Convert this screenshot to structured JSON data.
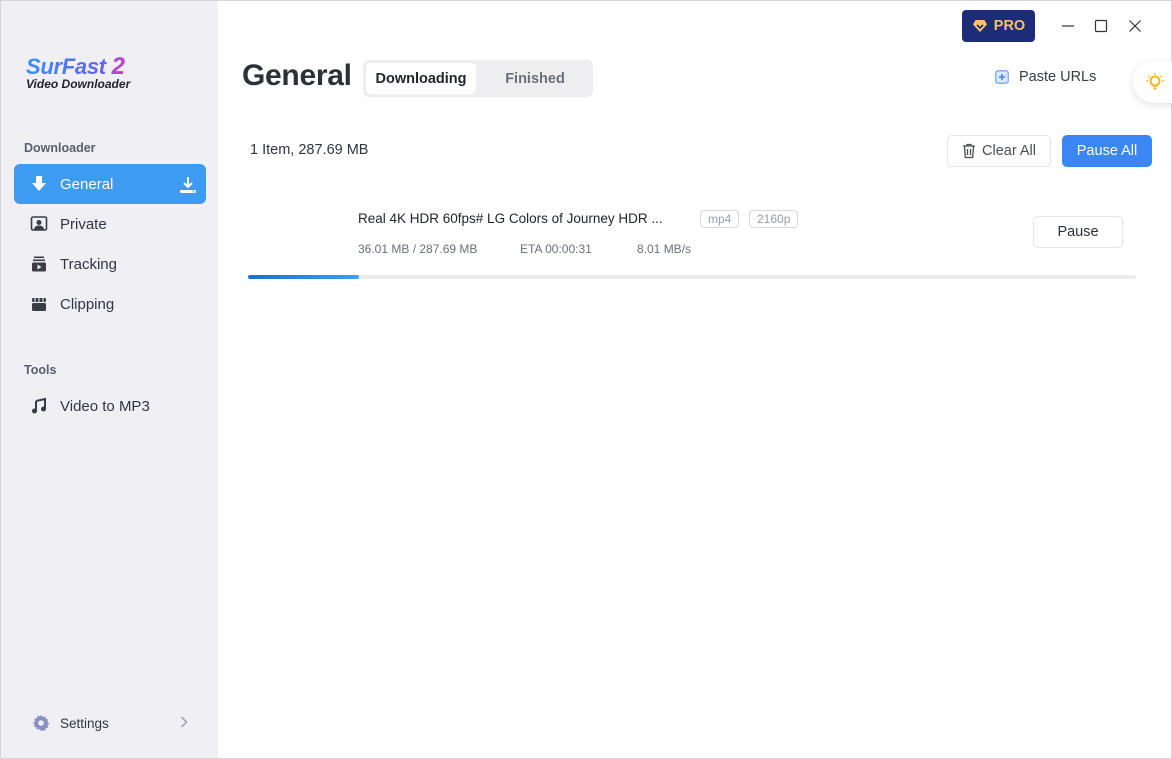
{
  "app": {
    "logo_line1": "SurFast",
    "logo_version": "2",
    "logo_line2": "Video Downloader"
  },
  "window_controls": {
    "pro_label": "PRO",
    "minimize": "minimize-icon",
    "maximize": "maximize-icon",
    "close": "close-icon"
  },
  "sidebar": {
    "sections": [
      {
        "label": "Downloader",
        "items": [
          {
            "label": "General",
            "icon": "download-arrow-icon",
            "active": true
          },
          {
            "label": "Private",
            "icon": "private-user-icon",
            "active": false
          },
          {
            "label": "Tracking",
            "icon": "tracking-play-icon",
            "active": false
          },
          {
            "label": "Clipping",
            "icon": "clapper-icon",
            "active": false
          }
        ]
      },
      {
        "label": "Tools",
        "items": [
          {
            "label": "Video to MP3",
            "icon": "music-note-icon",
            "active": false
          }
        ]
      }
    ],
    "settings_label": "Settings"
  },
  "main": {
    "title": "General",
    "tabs": [
      {
        "label": "Downloading",
        "active": true
      },
      {
        "label": "Finished",
        "active": false
      }
    ],
    "paste_urls_label": "Paste URLs",
    "summary": "1 Item, 287.69 MB",
    "clear_all_label": "Clear All",
    "pause_all_label": "Pause All",
    "accent_color": "#3b86f5",
    "downloads": [
      {
        "title": "Real 4K HDR 60fps# LG Colors of Journey HDR ...",
        "format": "mp4",
        "resolution": "2160p",
        "size_progress": "36.01 MB / 287.69 MB",
        "eta": "ETA 00:00:31",
        "speed": "8.01 MB/s",
        "progress_percent": 12.5,
        "action_label": "Pause"
      }
    ]
  }
}
